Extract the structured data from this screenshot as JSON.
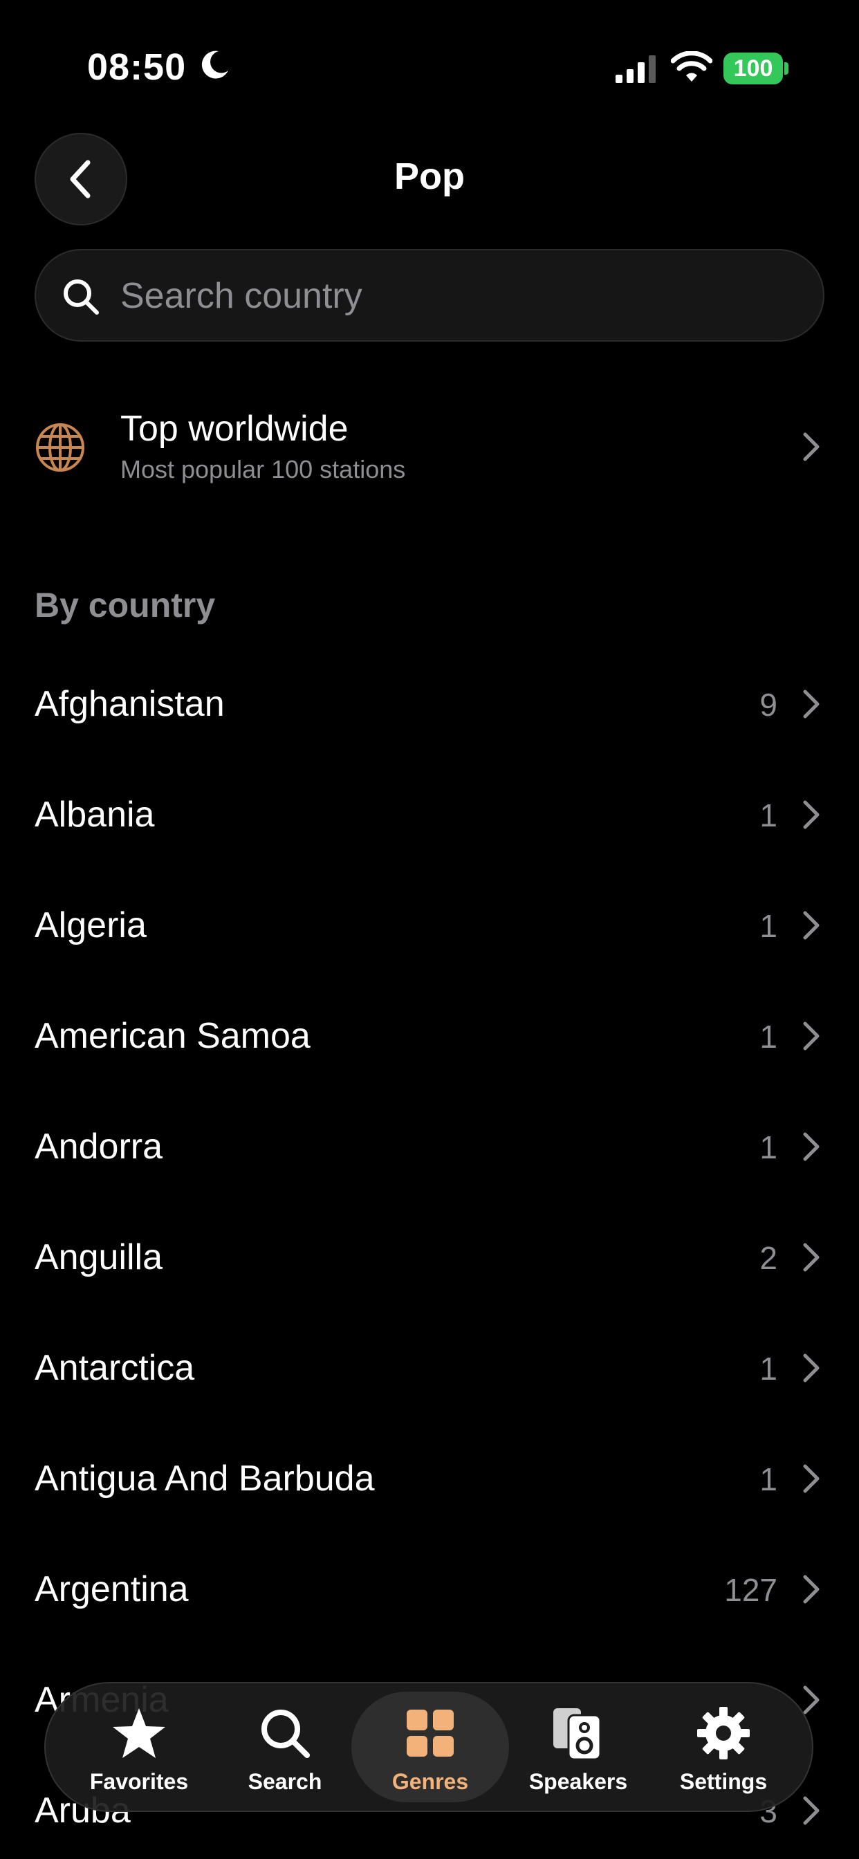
{
  "status_bar": {
    "time": "08:50",
    "battery": "100",
    "battery_color": "#34c759"
  },
  "header": {
    "title": "Pop",
    "back_icon": "chevron-left-icon"
  },
  "search": {
    "placeholder": "Search country",
    "value": ""
  },
  "top_worldwide": {
    "icon": "globe-icon",
    "title": "Top worldwide",
    "subtitle": "Most popular 100 stations"
  },
  "section": {
    "header": "By country"
  },
  "countries": [
    {
      "name": "Afghanistan",
      "count": "9"
    },
    {
      "name": "Albania",
      "count": "1"
    },
    {
      "name": "Algeria",
      "count": "1"
    },
    {
      "name": "American Samoa",
      "count": "1"
    },
    {
      "name": "Andorra",
      "count": "1"
    },
    {
      "name": "Anguilla",
      "count": "2"
    },
    {
      "name": "Antarctica",
      "count": "1"
    },
    {
      "name": "Antigua And Barbuda",
      "count": "1"
    },
    {
      "name": "Argentina",
      "count": "127"
    },
    {
      "name": "Armenia",
      "count": ""
    },
    {
      "name": "Aruba",
      "count": "3"
    }
  ],
  "tab_bar": {
    "tabs": [
      {
        "label": "Favorites",
        "icon": "star-icon"
      },
      {
        "label": "Search",
        "icon": "search-icon"
      },
      {
        "label": "Genres",
        "icon": "grid-icon",
        "active": true
      },
      {
        "label": "Speakers",
        "icon": "speaker-icon"
      },
      {
        "label": "Settings",
        "icon": "gear-icon"
      }
    ]
  },
  "colors": {
    "accent": "#f2b27a",
    "globe": "#c8874f",
    "secondary_text": "#8e8e93"
  }
}
